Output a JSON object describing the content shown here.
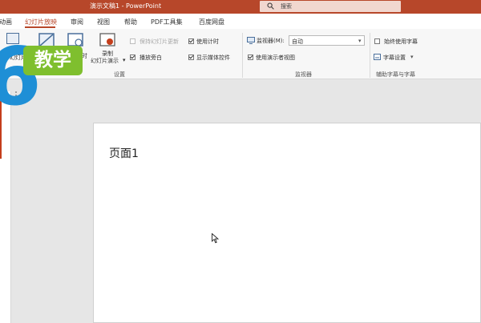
{
  "titlebar": {
    "title": "演示文稿1  -  PowerPoint",
    "search_placeholder": "搜索"
  },
  "tabs": [
    {
      "label": "动画",
      "active": false
    },
    {
      "label": "幻灯片放映",
      "active": true
    },
    {
      "label": "审阅",
      "active": false
    },
    {
      "label": "视图",
      "active": false
    },
    {
      "label": "帮助",
      "active": false
    },
    {
      "label": "PDF工具集",
      "active": false
    },
    {
      "label": "百度网盘",
      "active": false
    }
  ],
  "ribbon": {
    "partial_btn_a": {
      "line1": "设置",
      "line2": "幻灯片"
    },
    "partial_btn_c": "时",
    "record_button": {
      "line1": "录制",
      "line2": "幻灯片演示"
    },
    "setup_options": [
      {
        "label": "保持幻灯片更新",
        "checked": false,
        "enabled": false
      },
      {
        "label": "使用计时",
        "checked": true,
        "enabled": true
      },
      {
        "label": "播放旁白",
        "checked": true,
        "enabled": true
      },
      {
        "label": "显示媒体控件",
        "checked": true,
        "enabled": true
      }
    ],
    "setup_group_label": "设置",
    "monitor_label": "监视器(M):",
    "monitor_value": "自动",
    "presenter_view_label": "使用演示者视图",
    "monitor_group_label": "监视器",
    "subtitles_always_label": "始终使用字幕",
    "subtitle_settings_label": "字幕设置",
    "captions_group_label": "辅助字幕与字幕"
  },
  "logo": {
    "digit": "6",
    "badge_text": "教学"
  },
  "slide": {
    "text": "页面1"
  },
  "colors": {
    "accent": "#b7472a",
    "logo_blue": "#1e8fd6",
    "logo_green": "#7fbf2e"
  }
}
